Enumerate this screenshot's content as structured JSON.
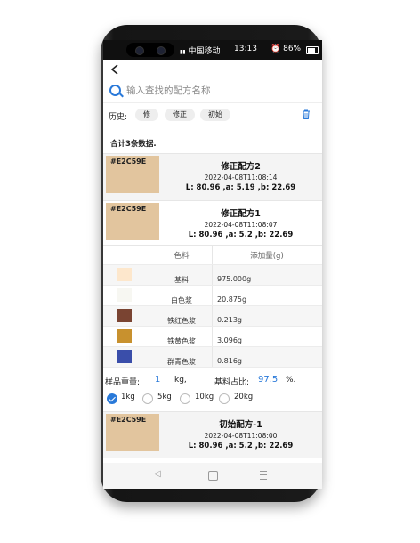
{
  "status_bar": {
    "carrier": "中国移动",
    "time": "13:13",
    "battery": "86%"
  },
  "search": {
    "placeholder": "输入查找的配方名称"
  },
  "history": {
    "label": "历史:",
    "chips": [
      "修",
      "修正",
      "初始"
    ]
  },
  "total_text": "合计3条数据.",
  "formulas": [
    {
      "code": "#E2C59E",
      "name": "修正配方2",
      "datetime": "2022-04-08T11:08:14",
      "lab": "L: 80.96 ,a: 5.19 ,b: 22.69",
      "swatch_color": "#E2C59E"
    },
    {
      "code": "#E2C59E",
      "name": "修正配方1",
      "datetime": "2022-04-08T11:08:07",
      "lab": "L: 80.96 ,a: 5.2 ,b: 22.69",
      "swatch_color": "#E2C59E"
    },
    {
      "code": "#E2C59E",
      "name": "初始配方-1",
      "datetime": "2022-04-08T11:08:00",
      "lab": "L: 80.96 ,a: 5.2 ,b: 22.69",
      "swatch_color": "#E2C59E"
    }
  ],
  "table": {
    "header": {
      "color": "色料",
      "amount": "添加量(g)"
    },
    "rows": [
      {
        "name": "基料",
        "amount": "975.000g",
        "color": "#FDE7CC"
      },
      {
        "name": "白色浆",
        "amount": "20.875g",
        "color": "#F7F7F2"
      },
      {
        "name": "铁红色浆",
        "amount": "0.213g",
        "color": "#7A4432"
      },
      {
        "name": "铁黄色浆",
        "amount": "3.096g",
        "color": "#C8912E"
      },
      {
        "name": "群青色浆",
        "amount": "0.816g",
        "color": "#3A4EAA"
      }
    ]
  },
  "weight": {
    "label": "样品重量:",
    "value": "1",
    "unit": "kg,",
    "ratio_label": "基料占比:",
    "ratio_value": "97.5",
    "ratio_unit": "%."
  },
  "options": {
    "items": [
      "1kg",
      "5kg",
      "10kg",
      "20kg"
    ],
    "selected": "1kg"
  },
  "colors": {
    "accent": "#2979D9"
  }
}
